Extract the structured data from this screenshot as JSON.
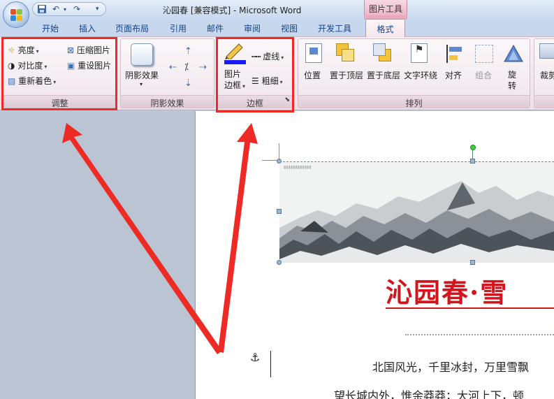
{
  "window": {
    "title": "沁园春 [兼容模式] - Microsoft Word",
    "context_tool_label": "图片工具"
  },
  "tabs": [
    {
      "label": "开始"
    },
    {
      "label": "插入"
    },
    {
      "label": "页面布局"
    },
    {
      "label": "引用"
    },
    {
      "label": "邮件"
    },
    {
      "label": "审阅"
    },
    {
      "label": "视图"
    },
    {
      "label": "开发工具"
    }
  ],
  "active_tab": {
    "label": "格式"
  },
  "ribbon": {
    "adjust": {
      "label": "调整",
      "brightness": "亮度",
      "contrast": "对比度",
      "recolor": "重新着色",
      "compress": "压缩图片",
      "reset": "重设图片"
    },
    "shadow": {
      "label": "阴影效果",
      "shadow_effects": "阴影效果"
    },
    "border": {
      "label": "边框",
      "picture_border_line1": "图片",
      "picture_border_line2": "边框",
      "dashes": "虚线",
      "weight": "粗细"
    },
    "arrange": {
      "label": "排列",
      "position": "位置",
      "bring_front": "置于顶层",
      "send_back": "置于底层",
      "text_wrap": "文字环绕",
      "align": "对齐",
      "group": "组合",
      "rotate_line1": "旋",
      "rotate_line2": "转"
    },
    "size": {
      "crop": "裁剪"
    }
  },
  "document": {
    "heading": "沁园春·雪",
    "line1": "北国风光，千里冰封，万里雪飘",
    "line2": "望长城内外，惟余莽莽；大河上下，顿"
  },
  "colors": {
    "annotation": "#ee2a24",
    "heading": "#d4141d",
    "border_color_bar": "#1a1aff"
  }
}
